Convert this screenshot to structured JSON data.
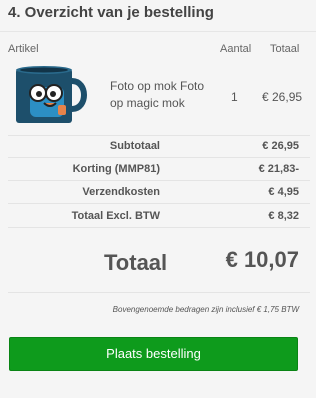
{
  "section": {
    "title": "4. Overzicht van je bestelling"
  },
  "table": {
    "headers": {
      "artikel": "Artikel",
      "aantal": "Aantal",
      "totaal": "Totaal"
    },
    "item": {
      "name": "Foto op mok Foto op magic mok",
      "quantity": "1",
      "total": "€ 26,95"
    }
  },
  "summary": {
    "rows": [
      {
        "label": "Subtotaal",
        "value": "€ 26,95"
      },
      {
        "label": "Korting (MMP81)",
        "value": "€ 21,83-"
      },
      {
        "label": "Verzendkosten",
        "value": "€ 4,95"
      },
      {
        "label": "Totaal Excl. BTW",
        "value": "€ 8,32"
      }
    ],
    "total_label": "Totaal",
    "total_value": "€ 10,07",
    "vat_note": "Bovengenoemde bedragen zijn inclusief € 1,75 BTW"
  },
  "actions": {
    "place_order": "Plaats bestelling"
  },
  "colors": {
    "button": "#0e9b1c",
    "panel_bg": "#f5f5f5",
    "text": "#555555"
  }
}
